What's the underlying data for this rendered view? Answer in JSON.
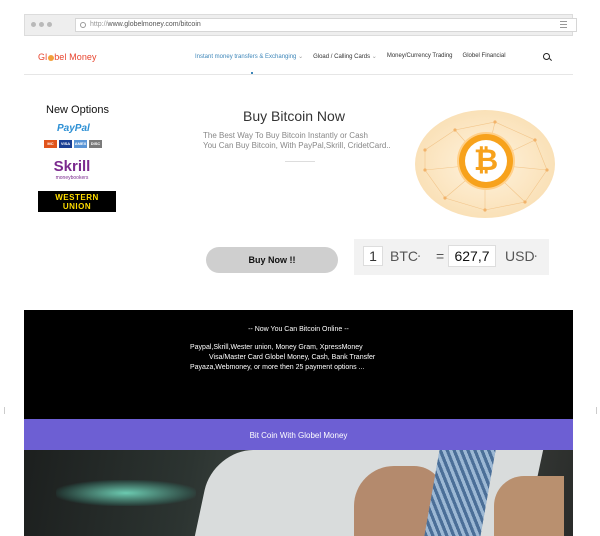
{
  "browser": {
    "url_prefix": "http://",
    "url_domain": "www.globelmoney.com/bitcoin"
  },
  "header": {
    "logo_text": {
      "before": "Gl",
      "after": "bel Money"
    },
    "menu": [
      {
        "label": "Instant money transfers & Exchanging",
        "caret": "⌄",
        "active": true
      },
      {
        "label": "Gload / Calling Cards",
        "caret": "⌄",
        "active": false
      },
      {
        "label": "Money/Currency Trading",
        "caret": "",
        "active": false
      },
      {
        "label": "Globel Financial",
        "caret": "",
        "active": false
      }
    ]
  },
  "options": {
    "title": "New Options",
    "paypal": "PayPal",
    "cards": [
      {
        "label": "MC",
        "color": "#e0541c"
      },
      {
        "label": "VISA",
        "color": "#1a3f93"
      },
      {
        "label": "AMEX",
        "color": "#5a95d6"
      },
      {
        "label": "DISC",
        "color": "#7a7a7a"
      }
    ],
    "skrill": "Skrill",
    "skrill_sub": "moneybookers",
    "western_union_line1": "WESTERN",
    "western_union_line2": "UNION"
  },
  "hero": {
    "title": "Buy Bitcoin Now",
    "desc_line1": "The Best Way To Buy Bitcoin Instantly or Cash",
    "desc_line2": "You Can Buy Bitcoin, With PayPal,Skrill, CridetCard..",
    "coin_symbol": "₿"
  },
  "buy": {
    "label": "Buy Now !!"
  },
  "converter": {
    "amount": "1",
    "from_currency": "BTC",
    "equals": "=",
    "result": "627,7",
    "to_currency": "USD",
    "dot": "•"
  },
  "promo": {
    "heading": "-- Now You Can Bitcoin Online --",
    "line1": "Paypal,Skrill,Wester union, Money Gram, XpressMoney",
    "line2": "Visa/Master Card Globel Money, Cash, Bank Transfer",
    "line3": "Payaza,Webmoney, or more then 25 payment options ..."
  },
  "banner": {
    "label": "Bit Coin With Globel Money"
  },
  "colors": {
    "accent": "#3d86b9",
    "brand": "#e8442e",
    "banner": "#6d5fd3",
    "coin": "#f7a21c"
  }
}
